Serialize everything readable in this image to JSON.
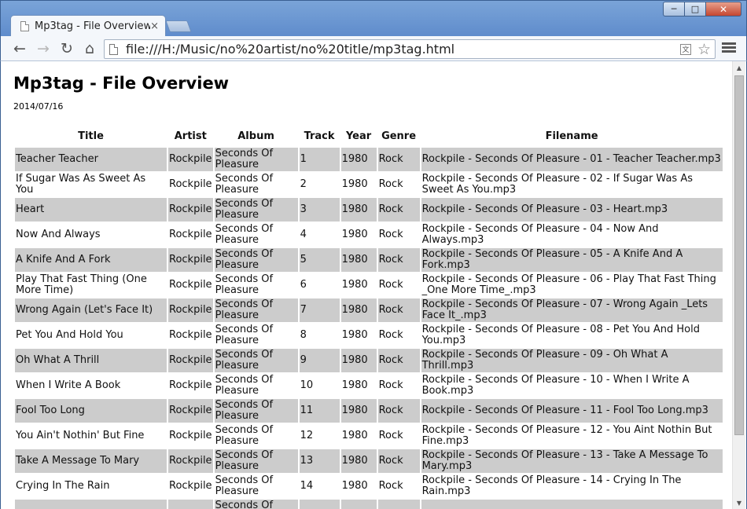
{
  "window": {
    "tab_title": "Mp3tag - File Overview",
    "minimize_glyph": "─",
    "maximize_glyph": "□",
    "close_glyph": "✕"
  },
  "toolbar": {
    "url": "file:///H:/Music/no%20artist/no%20title/mp3tag.html",
    "back_glyph": "←",
    "forward_glyph": "→",
    "reload_glyph": "↻",
    "home_glyph": "⌂",
    "star_glyph": "☆",
    "translate_glyph": "文",
    "tab_close_glyph": "×"
  },
  "icons": [
    "page-icon",
    "back-arrow-icon",
    "forward-arrow-icon",
    "reload-icon",
    "home-icon",
    "translate-icon",
    "star-icon",
    "menu-icon",
    "close-icon"
  ],
  "page": {
    "title": "Mp3tag - File Overview",
    "date": "2014/07/16"
  },
  "table": {
    "headers": {
      "title": "Title",
      "artist": "Artist",
      "album": "Album",
      "track": "Track",
      "year": "Year",
      "genre": "Genre",
      "filename": "Filename"
    },
    "rows": [
      {
        "title": "Teacher Teacher",
        "artist": "Rockpile",
        "album": "Seconds Of Pleasure",
        "track": "1",
        "year": "1980",
        "genre": "Rock",
        "filename": "Rockpile - Seconds Of Pleasure - 01 - Teacher Teacher.mp3"
      },
      {
        "title": "If Sugar Was As Sweet As You",
        "artist": "Rockpile",
        "album": "Seconds Of Pleasure",
        "track": "2",
        "year": "1980",
        "genre": "Rock",
        "filename": "Rockpile - Seconds Of Pleasure - 02 - If Sugar Was As Sweet As You.mp3"
      },
      {
        "title": "Heart",
        "artist": "Rockpile",
        "album": "Seconds Of Pleasure",
        "track": "3",
        "year": "1980",
        "genre": "Rock",
        "filename": "Rockpile - Seconds Of Pleasure - 03 - Heart.mp3"
      },
      {
        "title": "Now And Always",
        "artist": "Rockpile",
        "album": "Seconds Of Pleasure",
        "track": "4",
        "year": "1980",
        "genre": "Rock",
        "filename": "Rockpile - Seconds Of Pleasure - 04 - Now And Always.mp3"
      },
      {
        "title": "A Knife And A Fork",
        "artist": "Rockpile",
        "album": "Seconds Of Pleasure",
        "track": "5",
        "year": "1980",
        "genre": "Rock",
        "filename": "Rockpile - Seconds Of Pleasure - 05 - A Knife And A Fork.mp3"
      },
      {
        "title": "Play That Fast Thing (One More Time)",
        "artist": "Rockpile",
        "album": "Seconds Of Pleasure",
        "track": "6",
        "year": "1980",
        "genre": "Rock",
        "filename": "Rockpile - Seconds Of Pleasure - 06 - Play That Fast Thing _One More Time_.mp3"
      },
      {
        "title": "Wrong Again (Let's Face It)",
        "artist": "Rockpile",
        "album": "Seconds Of Pleasure",
        "track": "7",
        "year": "1980",
        "genre": "Rock",
        "filename": "Rockpile - Seconds Of Pleasure - 07 - Wrong Again _Lets Face It_.mp3"
      },
      {
        "title": "Pet You And Hold You",
        "artist": "Rockpile",
        "album": "Seconds Of Pleasure",
        "track": "8",
        "year": "1980",
        "genre": "Rock",
        "filename": "Rockpile - Seconds Of Pleasure - 08 - Pet You And Hold You.mp3"
      },
      {
        "title": "Oh What A Thrill",
        "artist": "Rockpile",
        "album": "Seconds Of Pleasure",
        "track": "9",
        "year": "1980",
        "genre": "Rock",
        "filename": "Rockpile - Seconds Of Pleasure - 09 - Oh What A Thrill.mp3"
      },
      {
        "title": "When I Write A Book",
        "artist": "Rockpile",
        "album": "Seconds Of Pleasure",
        "track": "10",
        "year": "1980",
        "genre": "Rock",
        "filename": "Rockpile - Seconds Of Pleasure - 10 - When I Write A Book.mp3"
      },
      {
        "title": "Fool Too Long",
        "artist": "Rockpile",
        "album": "Seconds Of Pleasure",
        "track": "11",
        "year": "1980",
        "genre": "Rock",
        "filename": "Rockpile - Seconds Of Pleasure - 11 - Fool Too Long.mp3"
      },
      {
        "title": "You Ain't Nothin' But Fine",
        "artist": "Rockpile",
        "album": "Seconds Of Pleasure",
        "track": "12",
        "year": "1980",
        "genre": "Rock",
        "filename": "Rockpile - Seconds Of Pleasure - 12 - You Aint Nothin But Fine.mp3"
      },
      {
        "title": "Take A Message To Mary",
        "artist": "Rockpile",
        "album": "Seconds Of Pleasure",
        "track": "13",
        "year": "1980",
        "genre": "Rock",
        "filename": "Rockpile - Seconds Of Pleasure - 13 - Take A Message To Mary.mp3"
      },
      {
        "title": "Crying In The Rain",
        "artist": "Rockpile",
        "album": "Seconds Of Pleasure",
        "track": "14",
        "year": "1980",
        "genre": "Rock",
        "filename": "Rockpile - Seconds Of Pleasure - 14 - Crying In The Rain.mp3"
      },
      {
        "title": "",
        "artist": "",
        "album": "Seconds Of Pleasure",
        "track": "",
        "year": "",
        "genre": "",
        "filename": ""
      }
    ]
  },
  "scrollbar": {
    "up_glyph": "▲",
    "down_glyph": "▼"
  },
  "colors": {
    "odd_row": "#cccccc",
    "window_frame": "#6a95cf"
  }
}
